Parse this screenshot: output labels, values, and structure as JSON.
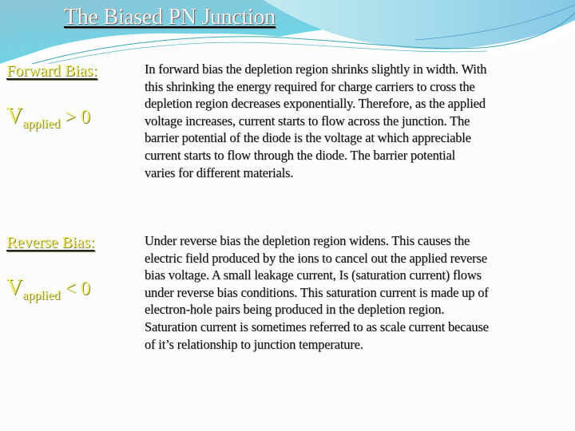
{
  "slide": {
    "title": "The Biased PN Junction",
    "colors": {
      "background": "#fbfcfc",
      "title_text": "#f4f4f4",
      "label_yellow": "#f4f060",
      "body_text": "#111111",
      "swoosh_light": "#a8e0ea",
      "swoosh_mid": "#7cc6dc",
      "swoosh_teal": "#3aa8b8"
    }
  },
  "forward": {
    "heading": "Forward Bias:",
    "v_symbol": "V",
    "v_subscript": "applied",
    "operator": "> 0",
    "lines": [
      "In forward bias the depletion region shrinks slightly in width.  With",
      "this shrinking the energy required for charge carriers to cross the",
      "depletion region decreases exponentially.  Therefore, as the applied",
      "voltage increases, current starts to flow across the junction.  The",
      "barrier potential of the diode is the voltage at which appreciable",
      "current starts to flow through the diode.  The barrier potential",
      "varies for different materials."
    ]
  },
  "reverse": {
    "heading": "Reverse Bias:",
    "v_symbol": "V",
    "v_subscript": "applied",
    "operator": "< 0",
    "lines": [
      "Under reverse bias the depletion region widens.  This causes the",
      "electric field produced by the ions to cancel out the applied reverse",
      "bias voltage.   A small leakage current, Is (saturation current) flows",
      "under reverse bias conditions.  This saturation current is made up of",
      "electron-hole pairs being produced in the depletion region.",
      "Saturation current is sometimes referred to as scale current because",
      "of it’s relationship to junction temperature."
    ]
  }
}
